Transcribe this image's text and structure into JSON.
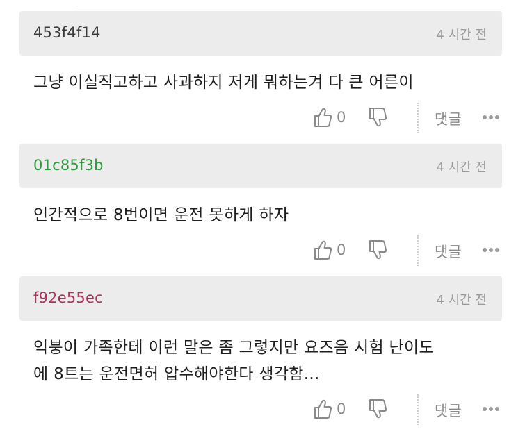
{
  "comments": [
    {
      "user_id": "453f4f14",
      "user_color": "#3a3a3a",
      "timestamp": "4 시간 전",
      "lines": [
        "그냥 이실직고하고 사과하지 저게 뭐하는겨 다 큰 어른이"
      ],
      "like_count": "0",
      "reply_label": "댓글"
    },
    {
      "user_id": "01c85f3b",
      "user_color": "#2e9a3e",
      "timestamp": "4 시간 전",
      "lines": [
        "인간적으로 8번이면 운전 못하게 하자"
      ],
      "like_count": "0",
      "reply_label": "댓글"
    },
    {
      "user_id": "f92e55ec",
      "user_color": "#b0325a",
      "timestamp": "4 시간 전",
      "lines": [
        "익붕이 가족한테 이런 말은 좀 그렇지만 요즈음 시험 난이도",
        "에 8트는 운전면허 압수해야한다 생각함..."
      ],
      "like_count": "0",
      "reply_label": "댓글"
    }
  ],
  "icons": {
    "like": "thumbs-up-outline",
    "dislike": "thumbs-down-outline",
    "more": "three-dots-horizontal"
  }
}
